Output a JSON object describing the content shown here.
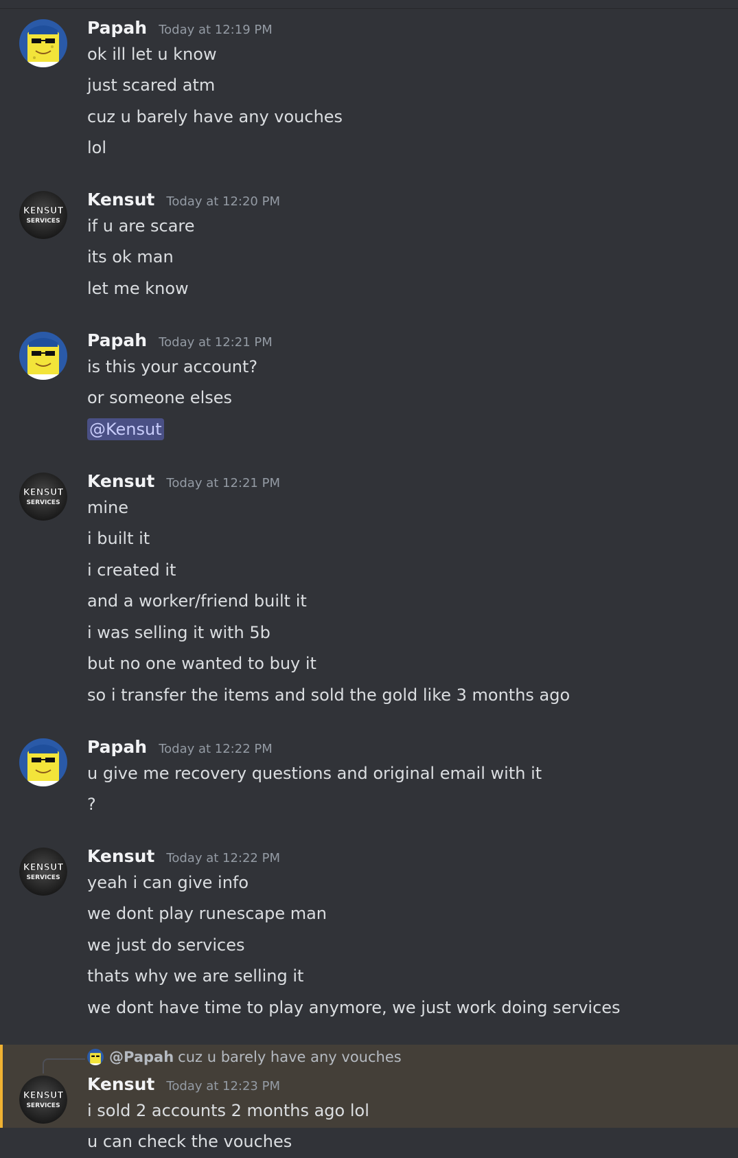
{
  "messages": [
    {
      "author": "Papah",
      "timestamp": "Today at 12:19 PM",
      "avatar": "spongebob-avatar",
      "lines": [
        "ok ill let u know",
        "just scared atm",
        "cuz u barely have any vouches",
        "lol"
      ]
    },
    {
      "author": "Kensut",
      "timestamp": "Today at 12:20 PM",
      "avatar": "kensut-services-avatar",
      "lines": [
        "if u are scare",
        "its ok man",
        "let me know"
      ]
    },
    {
      "author": "Papah",
      "timestamp": "Today at 12:21 PM",
      "avatar": "spongebob-avatar",
      "lines": [
        "is this your account?",
        "or someone elses"
      ],
      "mention": "@Kensut"
    },
    {
      "author": "Kensut",
      "timestamp": "Today at 12:21 PM",
      "avatar": "kensut-services-avatar",
      "lines": [
        "mine",
        "i built it",
        "i created it",
        "and a worker/friend built it",
        "i was selling it with 5b",
        "but no one wanted to buy it",
        "so i transfer the items and sold the gold like 3 months ago"
      ]
    },
    {
      "author": "Papah",
      "timestamp": "Today at 12:22 PM",
      "avatar": "spongebob-avatar",
      "lines": [
        "u give me recovery questions and original email with it",
        "?"
      ]
    },
    {
      "author": "Kensut",
      "timestamp": "Today at 12:22 PM",
      "avatar": "kensut-services-avatar",
      "lines": [
        "yeah i can give info",
        "we dont play runescape man",
        "we just do services",
        "thats why we are selling it",
        "we dont have time to play anymore, we just work doing services"
      ]
    },
    {
      "author": "Kensut",
      "timestamp": "Today at 12:23 PM",
      "avatar": "kensut-services-avatar",
      "reply_to": {
        "user": "@Papah",
        "text": "cuz u barely have any vouches"
      },
      "lines": [
        "i sold 2 accounts 2 months ago lol",
        "u can check the vouches"
      ]
    }
  ],
  "avatar_texts": {
    "kensut_top": "KENSUT",
    "kensut_bottom": "SERVICES"
  },
  "colors": {
    "background": "#313338",
    "mention_bg": "#4a5085",
    "highlight_bg": "#443f38",
    "highlight_bar": "#f0b232"
  }
}
